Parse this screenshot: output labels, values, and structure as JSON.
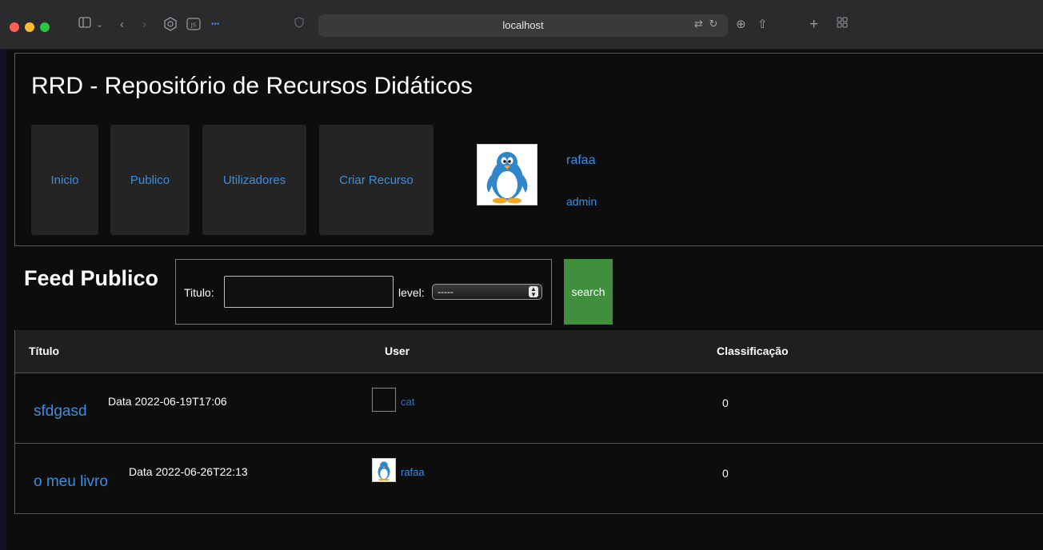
{
  "browser": {
    "url": "localhost"
  },
  "header": {
    "site_title": "RRD - Repositório de Recursos Didáticos",
    "nav": [
      "Inicio",
      "Publico",
      "Utilizadores",
      "Criar Recurso"
    ],
    "user": {
      "name": "rafaa",
      "role": "admin"
    }
  },
  "feed": {
    "title": "Feed Publico",
    "search": {
      "titulo_label": "Titulo:",
      "titulo_value": "",
      "level_label": "level:",
      "level_selected": "-----",
      "button_label": "search"
    }
  },
  "table": {
    "headers": [
      "Título",
      "User",
      "Classificação"
    ],
    "rows": [
      {
        "title": "sfdgasd",
        "date": "Data 2022-06-19T17:06",
        "user": "cat",
        "score": "0"
      },
      {
        "title": "o meu livro",
        "date": "Data 2022-06-26T22:13",
        "user": "rafaa",
        "score": "0"
      }
    ]
  },
  "colors": {
    "link": "#3d8ddf",
    "search_button": "#3f8f3d",
    "nav_bg": "#242424",
    "page_bg": "#0d0d0d"
  },
  "icons": [
    "sidebar-icon",
    "back-icon",
    "forward-icon",
    "extension-icon",
    "js-icon",
    "shield-icon",
    "translate-icon",
    "reload-icon",
    "download-icon",
    "share-icon",
    "new-tab-icon",
    "tab-overview-icon",
    "penguin-avatar-icon"
  ]
}
